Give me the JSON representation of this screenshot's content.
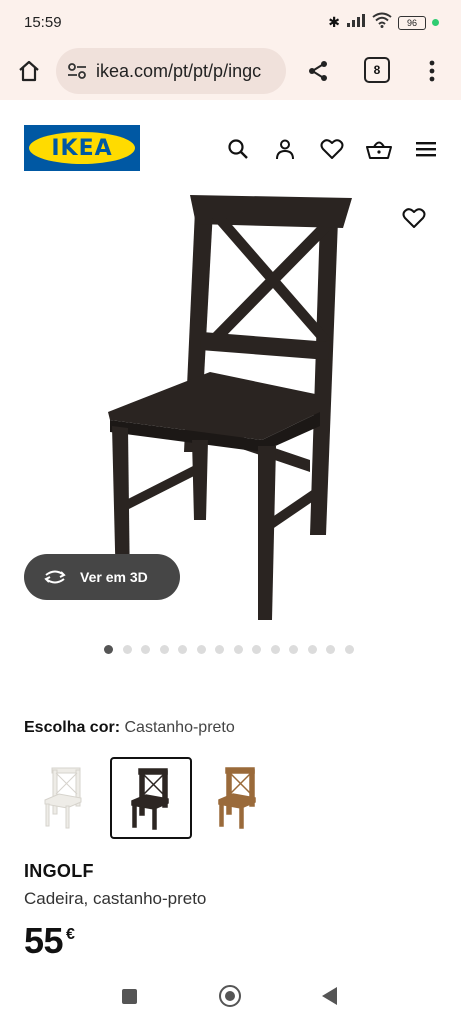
{
  "status": {
    "time": "15:59",
    "battery": "96"
  },
  "browser": {
    "url": "ikea.com/pt/pt/p/ingc",
    "tab_count": "8"
  },
  "site": {
    "logo_text": "IKEA"
  },
  "product": {
    "view_3d_label": "Ver em 3D",
    "color_label": "Escolha cor:",
    "color_value": "Castanho-preto",
    "name": "INGOLF",
    "description": "Cadeira, castanho-preto",
    "price": "55",
    "currency": "€",
    "carousel": {
      "total": 14,
      "active_index": 0
    },
    "swatches": [
      {
        "color": "#f1efea",
        "selected": false
      },
      {
        "color": "#2d2623",
        "selected": true
      },
      {
        "color": "#9a6a3a",
        "selected": false
      }
    ]
  },
  "colors": {
    "brand_blue": "#0058a3",
    "brand_yellow": "#ffdb00",
    "chair_dark": "#2a2421"
  }
}
